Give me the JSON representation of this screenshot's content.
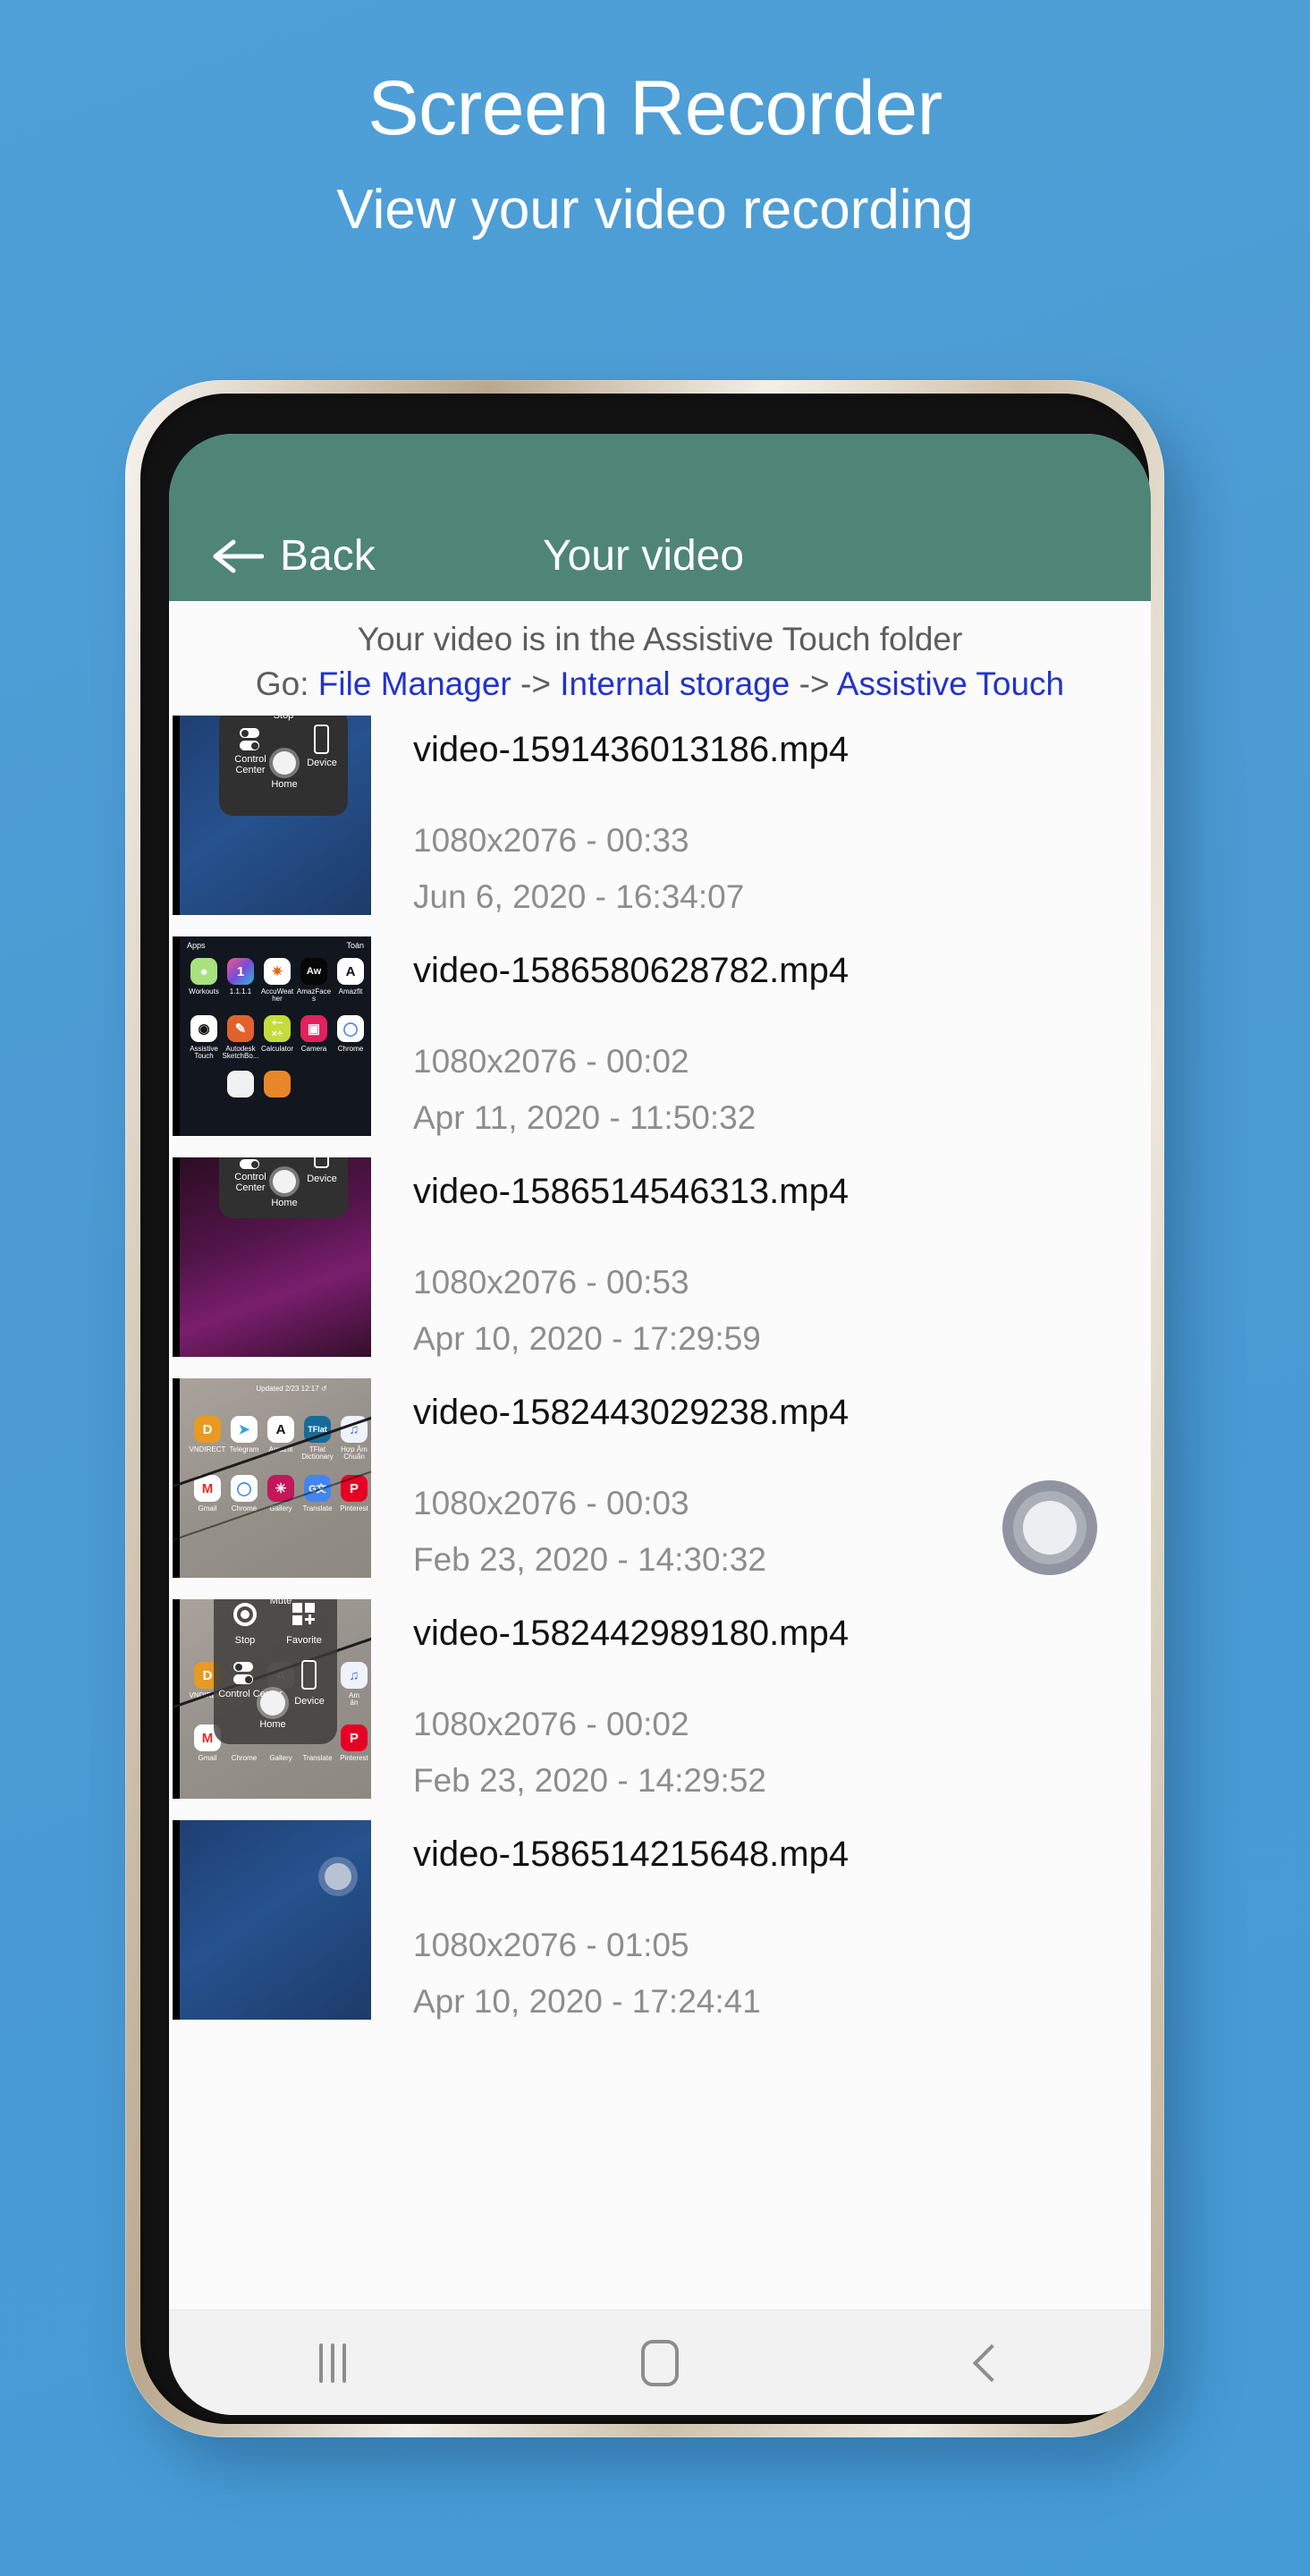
{
  "promo": {
    "title": "Screen Recorder",
    "subtitle": "View your video recording"
  },
  "colors": {
    "background_blue": "#4b9ad3",
    "appbar_green": "#4e8577",
    "link_blue": "#2233cc",
    "meta_gray": "#8d8d8d",
    "screen_bg": "#fbfbfb"
  },
  "appbar": {
    "back_label": "Back",
    "title": "Your video",
    "back_icon": "arrow-left-icon"
  },
  "hint": {
    "line1": "Your video is in the Assistive Touch folder",
    "prefix": "Go: ",
    "link1": "File Manager",
    "sep1": " -> ",
    "link2": "Internal storage",
    "sep2": " -> ",
    "link3": "Assistive Touch"
  },
  "videos": [
    {
      "name": "video-1591436013186.mp4",
      "resolution_duration": "1080x2076 - 00:33",
      "date": "Jun 6, 2020 - 16:34:07",
      "thumb": "assistive-panel-blue"
    },
    {
      "name": "video-1586580628782.mp4",
      "resolution_duration": "1080x2076 - 00:02",
      "date": "Apr 11, 2020 - 11:50:32",
      "thumb": "app-drawer-dark"
    },
    {
      "name": "video-1586514546313.mp4",
      "resolution_duration": "1080x2076 - 00:53",
      "date": "Apr 10, 2020 - 17:29:59",
      "thumb": "assistive-panel-purple"
    },
    {
      "name": "video-1582443029238.mp4",
      "resolution_duration": "1080x2076 - 00:03",
      "date": "Feb 23, 2020 - 14:30:32",
      "thumb": "home-screen-gray"
    },
    {
      "name": "video-1582442989180.mp4",
      "resolution_duration": "1080x2076 - 00:02",
      "date": "Feb 23, 2020 - 14:29:52",
      "thumb": "assistive-panel-gray"
    },
    {
      "name": "video-1586514215648.mp4",
      "resolution_duration": "1080x2076 - 01:05",
      "date": "Apr 10, 2020 - 17:24:41",
      "thumb": "plain-blue-bubble"
    }
  ],
  "thumb_art": {
    "assistive_panel_labels": {
      "stop": "Stop",
      "control_center": "Control\nCenter",
      "control_center_inline": "Control Center",
      "home": "Home",
      "device": "Device",
      "mute": "Mute",
      "favorite": "Favorite"
    },
    "app_drawer_dark": {
      "header_left": "Apps",
      "header_right": "Toán",
      "row1": [
        "Workouts",
        "1.1.1.1",
        "AccuWeat her",
        "AmazFace s",
        "Amazfit"
      ],
      "row2": [
        "Assistive Touch",
        "Autodesk SketchBo...",
        "Calculator",
        "Camera",
        "Chrome"
      ]
    },
    "home_screen_gray": {
      "status": "Updated 2/23 12:17",
      "row1": [
        "VNDIRECT",
        "Telegram",
        "Amazfit",
        "TFlat Dictionary",
        "Hợp Âm Chuẩn"
      ],
      "row2": [
        "Gmail",
        "Chrome",
        "Gallery",
        "Translate",
        "Pinterest"
      ]
    }
  },
  "assistive_bubble": {
    "name": "assistive-touch-bubble"
  },
  "navbar": {
    "recents": "recents-icon",
    "home": "home-icon",
    "back": "back-icon"
  }
}
